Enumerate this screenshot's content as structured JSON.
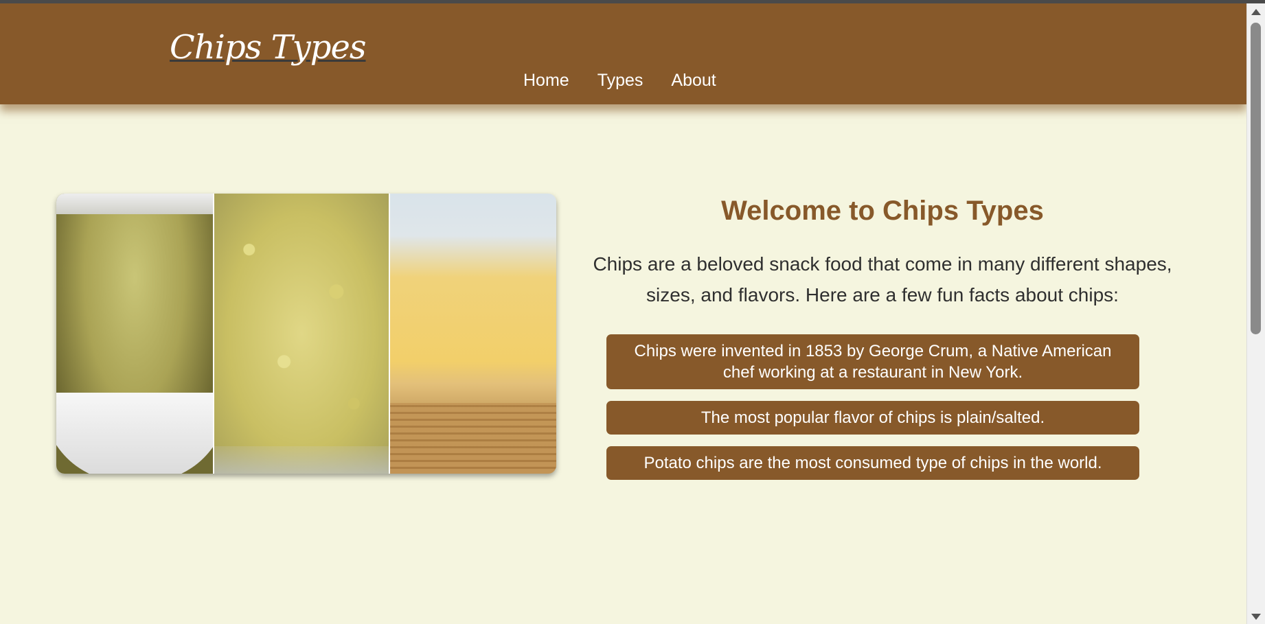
{
  "header": {
    "logo": "Chips Types",
    "nav": [
      "Home",
      "Types",
      "About"
    ]
  },
  "hero": {
    "image_alt": "three panels of chips: seasoned banana chips in a white bowl, flaked chips in a glass bowl, fried crisps in a wicker basket"
  },
  "main": {
    "title": "Welcome to Chips Types",
    "intro": "Chips are a beloved snack food that come in many different shapes, sizes, and flavors. Here are a few fun facts about chips:",
    "facts": [
      "Chips were invented in 1853 by George Crum, a Native American chef working at a restaurant in New York.",
      "The most popular flavor of chips is plain/salted.",
      "Potato chips are the most consumed type of chips in the world."
    ]
  },
  "colors": {
    "brand_brown": "#87592a",
    "page_background": "#f5f5df",
    "text_dark": "#2f2f2f"
  },
  "icons": [
    "scroll-up-arrow-icon",
    "scroll-down-arrow-icon"
  ]
}
